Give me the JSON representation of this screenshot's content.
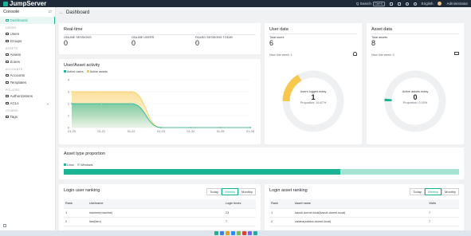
{
  "app": {
    "title": "JumpServer"
  },
  "topbar": {
    "search_label": "Q Search",
    "search_shortcut": "Ctrl+K",
    "language": "English",
    "user": "Administrator"
  },
  "sidebar": {
    "title": "Console",
    "items": [
      {
        "section": "",
        "label": "Dashboard",
        "active": true,
        "icon": "dashboard-icon"
      },
      {
        "section": "USERS",
        "label": "Users",
        "icon": "user-icon"
      },
      {
        "section": "",
        "label": "Groups",
        "icon": "group-icon"
      },
      {
        "section": "ASSETS",
        "label": "Assets",
        "icon": "server-icon"
      },
      {
        "section": "",
        "label": "Zones",
        "icon": "zone-icon"
      },
      {
        "section": "ACCOUNTS",
        "label": "Accounts",
        "icon": "account-icon"
      },
      {
        "section": "",
        "label": "Templates",
        "icon": "template-icon"
      },
      {
        "section": "POLICIES",
        "label": "Authorizations",
        "icon": "key-icon"
      },
      {
        "section": "",
        "label": "ACLs",
        "icon": "acl-icon"
      },
      {
        "section": "OTHERS",
        "label": "Tags",
        "icon": "tag-icon"
      }
    ]
  },
  "breadcrumb": {
    "title": "Dashboard"
  },
  "realtime": {
    "title": "Real-time",
    "stats": [
      {
        "label": "ONLINE SESSIONS",
        "value": "0"
      },
      {
        "label": "ONLINE USERS",
        "value": "0"
      },
      {
        "label": "FAILED SESSIONS TODAY",
        "value": "0"
      }
    ]
  },
  "user_data": {
    "title": "User data",
    "total_label": "Total users",
    "total": "6",
    "new_label": "New this week:",
    "new_value": "1",
    "gauge_label": "Users logged today",
    "gauge_value": "1",
    "gauge_prop": "Proportion: 16.67%",
    "gauge_fraction": 0.1667,
    "color": "#f8c84e"
  },
  "asset_data": {
    "title": "Asset data",
    "total_label": "Total assets",
    "total": "8",
    "new_label": "New this week:",
    "new_value": "0",
    "gauge_label": "Active assets today",
    "gauge_value": "0",
    "gauge_prop": "Proportion: 0.00%",
    "gauge_fraction": 0.0,
    "color": "#1ab394"
  },
  "activity": {
    "title": "User/Asset activity",
    "chart_data": {
      "type": "area",
      "title": "User/Asset activity",
      "x": [
        "01-20",
        "01-21",
        "01-22",
        "01-23",
        "01-24",
        "01-25",
        "01-26"
      ],
      "ylim": [
        0,
        4
      ],
      "yticks": [
        "0",
        "1",
        "2",
        "3",
        "4"
      ],
      "series": [
        {
          "name": "Active users",
          "color": "#1ab394",
          "values": [
            2,
            2,
            2,
            0,
            0,
            0,
            0
          ]
        },
        {
          "name": "Active assets",
          "color": "#f8c84e",
          "values": [
            3,
            3,
            3,
            0,
            0,
            0,
            0
          ]
        }
      ]
    }
  },
  "asset_type": {
    "title": "Asset type proportion",
    "legend": [
      {
        "name": "Linux",
        "color": "#1ab394"
      },
      {
        "name": "Windows",
        "color": "#a7e3d5"
      }
    ],
    "fractions": [
      0.7,
      0.3
    ]
  },
  "login_user": {
    "title": "Login user ranking",
    "tabs": [
      "Today",
      "Weekly",
      "Monthly"
    ],
    "active_tab": 1,
    "columns": [
      "Rank",
      "Username",
      "Login times"
    ],
    "rows": [
      [
        "1",
        "maxime(maxime)",
        "23"
      ],
      [
        "2",
        "lam(lam)",
        "7"
      ]
    ]
  },
  "login_asset": {
    "title": "Login asset ranking",
    "tabs": [
      "Today",
      "Weekly",
      "Monthly"
    ],
    "active_tab": 1,
    "columns": [
      "Rank",
      "Asset name",
      "Visits"
    ],
    "rows": [
      [
        "1",
        "kazuh.domel.local(kazuh.domel.local)",
        "7"
      ],
      [
        "2",
        "zaldea(zaldea.domel.local)",
        "7"
      ]
    ]
  },
  "taskbar": {
    "icons": [
      "#1ab394",
      "#3f7fd8",
      "#e4a11b",
      "#2d8cf0",
      "#6cc24a",
      "#d8413c",
      "#7b61ff",
      "#2aa6a0"
    ]
  }
}
